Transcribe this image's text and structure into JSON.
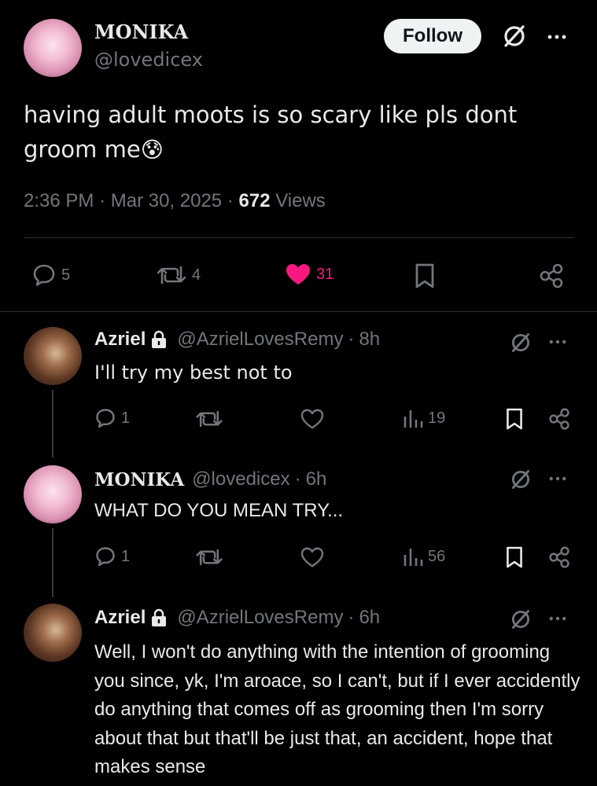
{
  "main_post": {
    "display_name": "MONIKA",
    "handle": "@lovedicex",
    "follow_label": "Follow",
    "text": "having adult moots is so scary like pls dont groom me",
    "emoji": "😰",
    "time": "2:36 PM",
    "date": "Mar 30, 2025",
    "views_count": "672",
    "views_label": "Views",
    "replies": "5",
    "reposts": "4",
    "likes": "31",
    "like_color": "#f91880"
  },
  "replies": [
    {
      "display_name": "Azriel",
      "handle": "@AzrielLovesRemy",
      "time": "8h",
      "text": "I'll try my best not to",
      "reply_count": "1",
      "views": "19",
      "protected": true
    },
    {
      "display_name": "MONIKA",
      "handle": "@lovedicex",
      "time": "6h",
      "text": "WHAT DO YOU MEAN TRY...",
      "reply_count": "1",
      "views": "56",
      "protected": false
    },
    {
      "display_name": "Azriel",
      "handle": "@AzrielLovesRemy",
      "time": "6h",
      "text": "Well, I won't do anything with the intention of grooming you since, yk, I'm aroace, so I can't, but if I ever accidently do anything that comes off as grooming then I'm sorry about that but that'll be just that, an accident, hope that makes sense",
      "protected": true
    }
  ],
  "separator": "·"
}
